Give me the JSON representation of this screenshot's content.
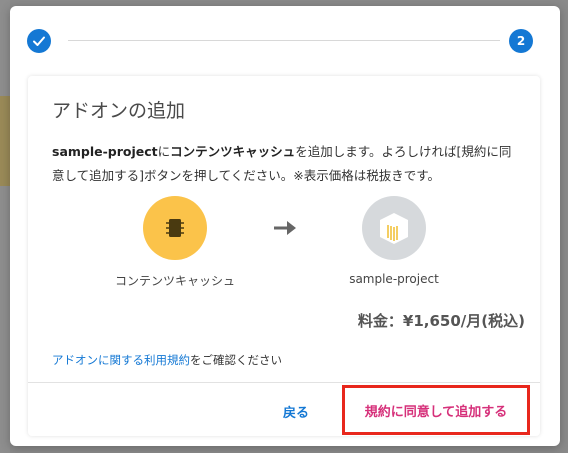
{
  "stepper": {
    "step1_icon": "check-icon",
    "step2_number": "2"
  },
  "dialog": {
    "title": "アドオンの追加",
    "description": {
      "project": "sample-project",
      "text1": "に",
      "addon": "コンテンツキャッシュ",
      "text2": "を追加します。よろしければ[規約に同意して追加する]ボタンを押してください。※表示価格は税抜きです。"
    },
    "addon": {
      "label": "コンテンツキャッシュ",
      "icon": "chip-icon",
      "color": "#fbc34a"
    },
    "arrow_icon": "arrow-right-icon",
    "project": {
      "label": "sample-project",
      "icon": "project-box-icon",
      "color": "#d6d9dc"
    },
    "price": "料金：¥1,650/月(税込)",
    "terms": {
      "link": "アドオンに関する利用規約",
      "text": "をご確認ください"
    },
    "buttons": {
      "back": "戻る",
      "agree": "規約に同意して追加する"
    }
  },
  "colors": {
    "accent": "#1478d4",
    "highlight_border": "#e8271c",
    "agree_text": "#d6307a"
  }
}
